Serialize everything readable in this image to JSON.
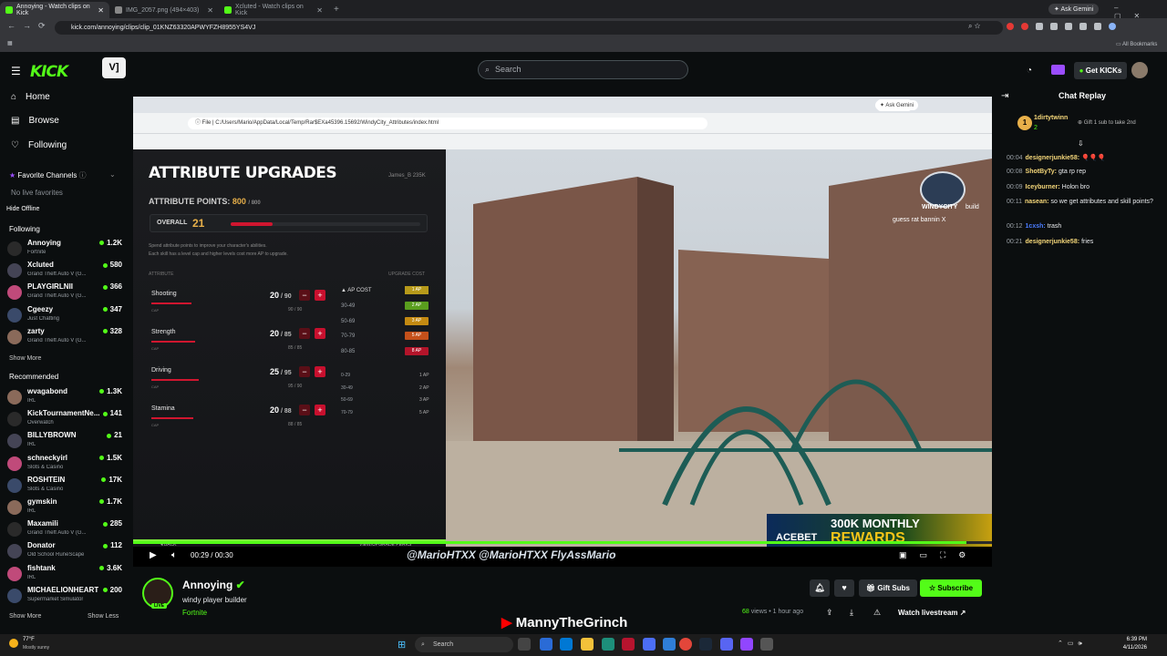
{
  "browser": {
    "tabs": [
      {
        "label": "Annoying - Watch clips on Kick",
        "active": true
      },
      {
        "label": "IMG_2057.png (494×403)",
        "active": false
      },
      {
        "label": "Xcluted - Watch clips on Kick",
        "active": false
      }
    ],
    "ask_gemini": "Ask Gemini",
    "url": "kick.com/annoying/clips/clip_01KNZ63320APWYFZH8955YS4VJ",
    "all_bookmarks": "All Bookmarks"
  },
  "kick": {
    "logo": "KICK",
    "search_placeholder": "Search",
    "get_kicks": "Get KICKs",
    "nav": [
      {
        "label": "Home",
        "icon": "home-icon"
      },
      {
        "label": "Browse",
        "icon": "browse-icon"
      },
      {
        "label": "Following",
        "icon": "heart-icon"
      }
    ],
    "favorite_channels": "Favorite Channels",
    "no_live_favorites": "No live favorites",
    "hide_offline": "Hide Offline",
    "following_header": "Following",
    "following": [
      {
        "name": "Annoying",
        "game": "Fortnite",
        "viewers": "1.2K"
      },
      {
        "name": "Xcluted",
        "game": "Grand Theft Auto V (G...",
        "viewers": "580"
      },
      {
        "name": "PLAYGIRLNII",
        "game": "Grand Theft Auto V (G...",
        "viewers": "366"
      },
      {
        "name": "Cgeezy",
        "game": "Just Chatting",
        "viewers": "347"
      },
      {
        "name": "zarty",
        "game": "Grand Theft Auto V (G...",
        "viewers": "328"
      }
    ],
    "show_more_1": "Show More",
    "recommended_header": "Recommended",
    "recommended": [
      {
        "name": "wvagabond",
        "game": "IRL",
        "viewers": "1.3K"
      },
      {
        "name": "KickTournamentNe...",
        "game": "Overwatch",
        "viewers": "141"
      },
      {
        "name": "BILLYBROWN",
        "game": "IRL",
        "viewers": "21"
      },
      {
        "name": "schneckyirl",
        "game": "Slots & Casino",
        "viewers": "1.5K"
      },
      {
        "name": "ROSHTEIN",
        "game": "Slots & Casino",
        "viewers": "17K"
      },
      {
        "name": "gymskin",
        "game": "IRL",
        "viewers": "1.7K"
      },
      {
        "name": "Maxamili",
        "game": "Grand Theft Auto V (G...",
        "viewers": "285"
      },
      {
        "name": "Donator",
        "game": "Old School RuneScape",
        "viewers": "112"
      },
      {
        "name": "fishtank",
        "game": "IRL",
        "viewers": "3.6K"
      },
      {
        "name": "MICHAELIONHEART",
        "game": "Supermarket Simulator",
        "viewers": "200"
      }
    ],
    "show_more_2": "Show More",
    "show_less": "Show Less"
  },
  "video": {
    "inner_url": "C:/Users/Mario/AppData/Local/Temp/Rar$EXa45396.15692/WindyCity_Attributes/index.html",
    "inner_file": "File",
    "inner_ask_gemini": "Ask Gemini",
    "title": "ATTRIBUTE UPGRADES",
    "player": "James_B",
    "player_rep": "235K",
    "points_label": "ATTRIBUTE POINTS:",
    "points_value": "800",
    "points_max": "/ 800",
    "overall_label": "OVERALL",
    "overall_value": "21",
    "overall_fill": 0.22,
    "desc1": "Spend attribute points to improve your character's abilities.",
    "desc2": "Each skill has a level cap and higher levels cost more AP to upgrade.",
    "col_attribute": "ATTRIBUTE",
    "col_upgrade_cost": "UPGRADE COST",
    "attributes": [
      {
        "name": "Shooting",
        "value": "20",
        "max": "/ 90",
        "cap": "90 / 90",
        "fill": 0.22
      },
      {
        "name": "Strength",
        "value": "20",
        "max": "/ 85",
        "cap": "85 / 85",
        "fill": 0.24
      },
      {
        "name": "Driving",
        "value": "25",
        "max": "/ 95",
        "cap": "95 / 90",
        "fill": 0.26
      },
      {
        "name": "Stamina",
        "value": "20",
        "max": "/ 88",
        "cap": "88 / 85",
        "fill": 0.23
      }
    ],
    "ap_cost_label": "AP COST",
    "tiers": [
      {
        "range": "30-49",
        "cost": "2 AP",
        "color": "#5a9e1e"
      },
      {
        "range": "50-69",
        "cost": "3 AP",
        "color": "#c48a12"
      },
      {
        "range": "70-79",
        "cost": "5 AP",
        "color": "#c4501a"
      },
      {
        "range": "80-85",
        "cost": "8 AP",
        "color": "#b3142a"
      }
    ],
    "tier_top": "1 AP",
    "tiers2": [
      {
        "range": "0-29",
        "cost": "1 AP"
      },
      {
        "range": "30-49",
        "cost": "2 AP"
      },
      {
        "range": "50-69",
        "cost": "3 AP"
      },
      {
        "range": "70-79",
        "cost": "5 AP"
      }
    ],
    "back": "BACK",
    "view_perks": "VIEW/UPGRADE PERKS",
    "watermark": "WINDYCITY",
    "overlay_chat1": "build",
    "overlay_chat2": "guess rat bannin X",
    "ad_line1": "300K MONTHLY",
    "ad_brand": "ACEBET",
    "ad_line2": "REWARDS",
    "socials": "@MarioHTXX  @MarioHTXX  FlyAssMario",
    "time": "00:29 / 00:30",
    "progress": 0.97
  },
  "stream": {
    "streamer": "Annoying",
    "title": "windy player builder",
    "category": "Fortnite",
    "live_badge": "LIVE",
    "gift_subs": "Gift Subs",
    "subscribe": "Subscribe",
    "views_count": "68",
    "views_label": "views",
    "time_ago": "1 hour ago",
    "watch_livestream": "Watch livestream",
    "channel_overlay": "MannyTheGrinch"
  },
  "chat": {
    "title": "Chat Replay",
    "pinned_user": "1dirtytwinn",
    "pinned_count": "2",
    "pinned_text": "Gift 1 sub to take 2nd",
    "messages": [
      {
        "time": "00:04",
        "user": "designerjunkie58:",
        "text": "🎈🎈🎈",
        "color": "#f5d77a"
      },
      {
        "time": "00:08",
        "user": "ShotByTy:",
        "text": "gta rp rep",
        "color": "#f5d77a"
      },
      {
        "time": "00:09",
        "user": "Iceyburner:",
        "text": "Holon bro",
        "color": "#f5d77a"
      },
      {
        "time": "00:11",
        "user": "nasean:",
        "text": "so we get attributes and skill points?",
        "color": "#f5d77a"
      },
      {
        "time": "00:12",
        "user": "1cxsh:",
        "text": "trash",
        "color": "#4a7cff"
      },
      {
        "time": "00:21",
        "user": "designerjunkie58:",
        "text": "fries",
        "color": "#f5d77a"
      }
    ]
  },
  "taskbar": {
    "weather_temp": "77°F",
    "weather_desc": "Mostly sunny",
    "search": "Search",
    "clock_time": "6:39 PM",
    "clock_date": "4/11/2026"
  }
}
